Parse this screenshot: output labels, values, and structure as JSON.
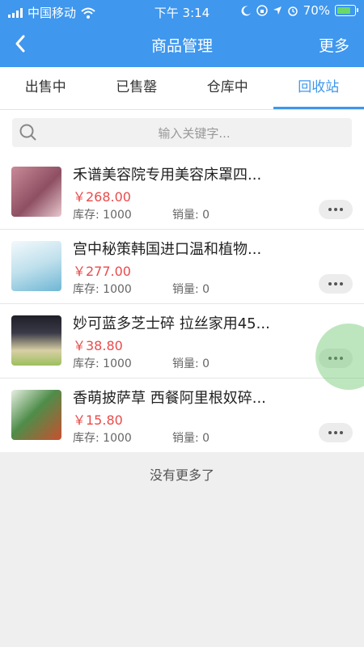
{
  "statusbar": {
    "carrier": "中国移动",
    "time": "下午 3:14",
    "battery": "70%",
    "battery_level": 0.7,
    "icons": [
      "signal-icon",
      "wifi-icon",
      "moon-icon",
      "orientation-lock-icon",
      "location-icon",
      "alarm-icon",
      "battery-icon"
    ]
  },
  "nav": {
    "title": "商品管理",
    "more": "更多"
  },
  "tabs": [
    {
      "label": "出售中",
      "active": false
    },
    {
      "label": "已售罄",
      "active": false
    },
    {
      "label": "仓库中",
      "active": false
    },
    {
      "label": "回收站",
      "active": true
    }
  ],
  "search": {
    "placeholder": "输入关键字..."
  },
  "products": [
    {
      "title": "禾谱美容院专用美容床罩四...",
      "price": "￥268.00",
      "stock": "库存: 1000",
      "sales": "销量: 0",
      "thumb_color": "#b77a8a"
    },
    {
      "title": "宫中秘策韩国进口温和植物...",
      "price": "￥277.00",
      "stock": "库存: 1000",
      "sales": "销量: 0",
      "thumb_color": "#dcecf3"
    },
    {
      "title": "妙可蓝多芝士碎 拉丝家用45...",
      "price": "￥38.80",
      "stock": "库存: 1000",
      "sales": "销量: 0",
      "thumb_color": "#2a2a35"
    },
    {
      "title": "香萌披萨草 西餐阿里根奴碎...",
      "price": "￥15.80",
      "stock": "库存: 1000",
      "sales": "销量: 0",
      "thumb_color": "#4f8d4a"
    }
  ],
  "footer": {
    "text": "没有更多了"
  },
  "colors": {
    "primary": "#3f97ee",
    "price": "#e94b4b"
  }
}
